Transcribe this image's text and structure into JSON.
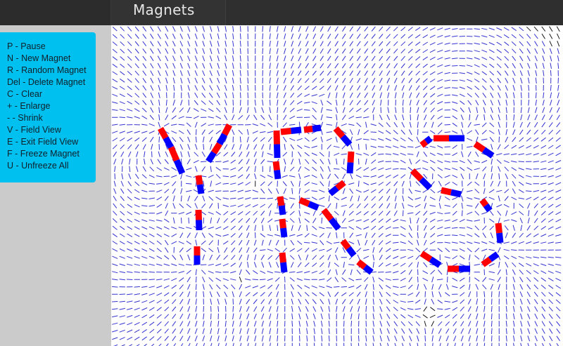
{
  "app": {
    "title": "Magnets"
  },
  "help": {
    "items": [
      "P - Pause",
      "N - New Magnet",
      "R - Random Magnet",
      "Del - Delete Magnet",
      "C - Clear",
      "+ - Enlarge",
      "- - Shrink",
      "V - Field View",
      "E - Exit Field View",
      "F - Freeze Magnet",
      "U - Unfreeze All"
    ]
  },
  "colors": {
    "topbar": "#2e2e2e",
    "help_panel": "#00c0f0",
    "magnet_north": "#ff0000",
    "magnet_south": "#0000ff",
    "field_line_strong": "#1010c8",
    "field_line_weak": "#000000"
  },
  "field_view": true
}
